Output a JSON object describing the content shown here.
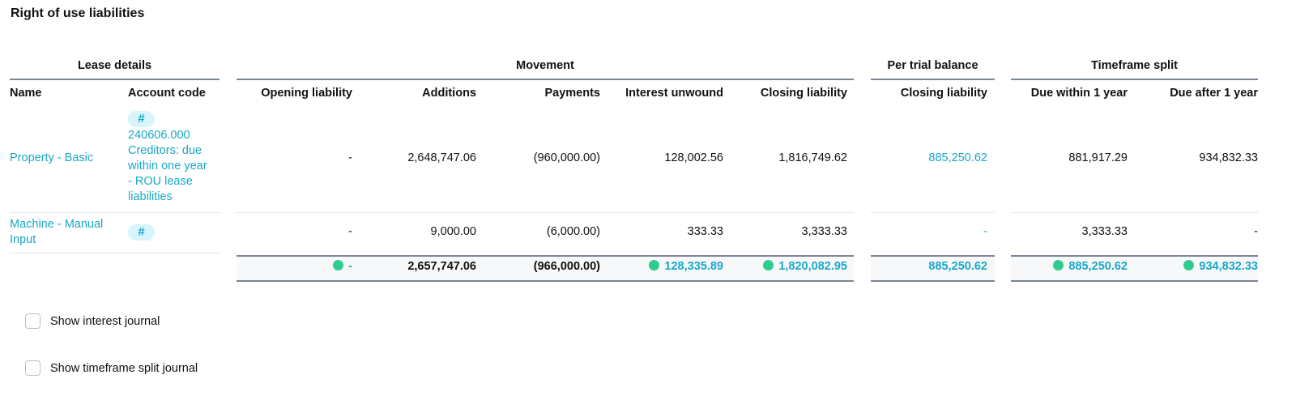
{
  "title": "Right of use liabilities",
  "groups": {
    "lease_details": "Lease details",
    "movement": "Movement",
    "per_trial_balance": "Per trial balance",
    "timeframe_split": "Timeframe split"
  },
  "columns": {
    "name": "Name",
    "account_code": "Account code",
    "opening_liability": "Opening liability",
    "additions": "Additions",
    "payments": "Payments",
    "interest_unwound": "Interest unwound",
    "closing_liability": "Closing liability",
    "tb_closing_liability": "Closing liability",
    "due_within": "Due within 1 year",
    "due_after": "Due after 1 year"
  },
  "rows": [
    {
      "name": "Property - Basic",
      "account_badge": "#",
      "account_code": "240606.000",
      "account_desc_1": "Creditors: due",
      "account_desc_2": "within one year",
      "account_desc_3": "- ROU lease",
      "account_desc_4": "liabilities",
      "opening": "-",
      "additions": "2,648,747.06",
      "payments": "(960,000.00)",
      "interest": "128,002.56",
      "closing": "1,816,749.62",
      "tb_closing": "885,250.62",
      "due_within": "881,917.29",
      "due_after": "934,832.33"
    },
    {
      "name_line1": "Machine - Manual",
      "name_line2": "Input",
      "account_badge": "#",
      "opening": "-",
      "additions": "9,000.00",
      "payments": "(6,000.00)",
      "interest": "333.33",
      "closing": "3,333.33",
      "tb_closing": "-",
      "due_within": "3,333.33",
      "due_after": "-"
    }
  ],
  "totals": {
    "opening": "-",
    "additions": "2,657,747.06",
    "payments": "(966,000.00)",
    "interest": "128,335.89",
    "closing": "1,820,082.95",
    "tb_closing": "885,250.62",
    "due_within": "885,250.62",
    "due_after": "934,832.33"
  },
  "checkboxes": {
    "interest_journal": "Show interest journal",
    "timeframe_journal": "Show timeframe split journal"
  },
  "colors": {
    "link": "#19a8c8",
    "status_dot": "#2ecc8f",
    "rule": "#7b8594"
  }
}
